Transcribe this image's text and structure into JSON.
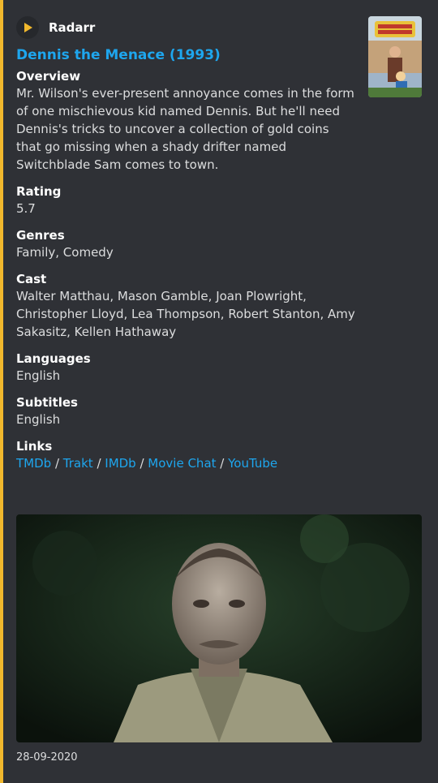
{
  "author": {
    "name": "Radarr",
    "icon": "radarr-play-icon"
  },
  "title": "Dennis the Menace (1993)",
  "fields": {
    "overview": {
      "name": "Overview",
      "value": "Mr. Wilson's ever-present annoyance comes in the form of one mischievous kid named Dennis. But he'll need Dennis's tricks to uncover a collection of gold coins that go missing when a shady drifter named Switchblade Sam comes to town."
    },
    "rating": {
      "name": "Rating",
      "value": "5.7"
    },
    "genres": {
      "name": "Genres",
      "value": "Family, Comedy"
    },
    "cast": {
      "name": "Cast",
      "value": "Walter Matthau, Mason Gamble, Joan Plowright, Christopher Lloyd, Lea Thompson, Robert Stanton, Amy Sakasitz, Kellen Hathaway"
    },
    "languages": {
      "name": "Languages",
      "value": "English"
    },
    "subtitles": {
      "name": "Subtitles",
      "value": "English"
    },
    "links": {
      "name": "Links",
      "separator": " / ",
      "items": [
        "TMDb",
        "Trakt",
        "IMDb",
        "Movie Chat",
        "YouTube"
      ]
    }
  },
  "footer": {
    "date": "28-09-2020"
  },
  "colors": {
    "accent_bar": "#f1b82d",
    "link": "#1ea6ee",
    "background": "#2f3136"
  }
}
